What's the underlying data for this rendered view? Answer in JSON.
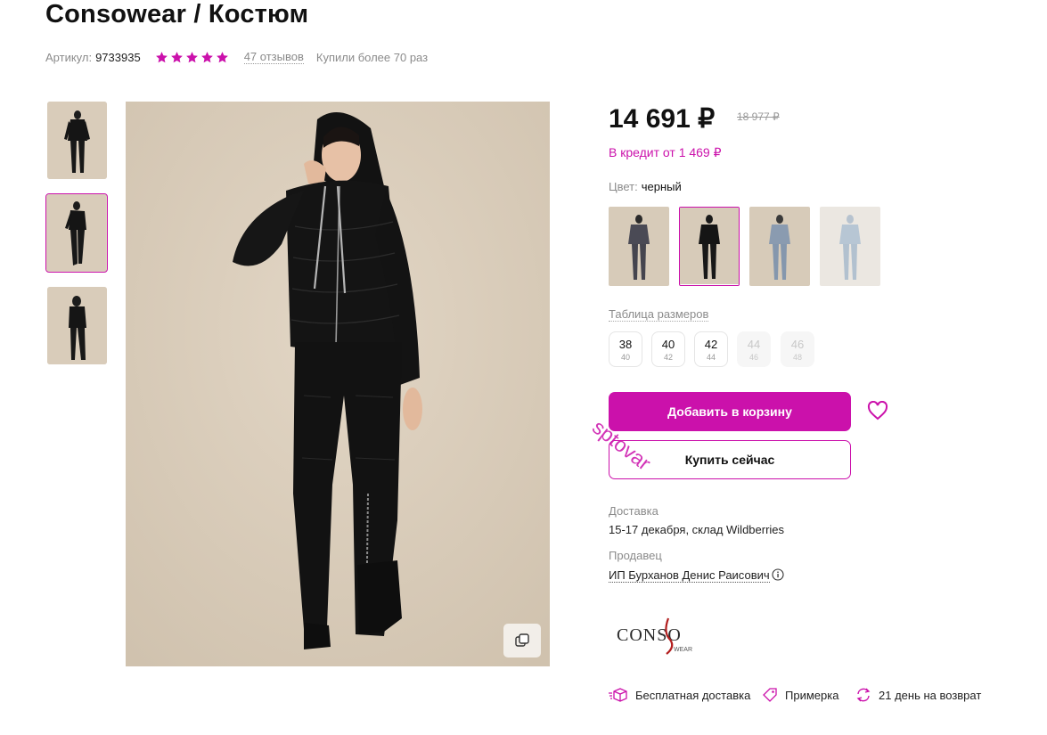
{
  "product": {
    "title": "Consowear / Костюм",
    "article_label": "Артикул:",
    "article_value": "9733935",
    "rating_stars": 5,
    "reviews": "47 отзывов",
    "purchases": "Купили более 70 раз"
  },
  "price": {
    "current": "14 691 ₽",
    "old": "18 977 ₽",
    "credit": "В кредит от 1 469 ₽"
  },
  "color": {
    "label": "Цвет:",
    "value": "черный",
    "swatches": [
      "graphite",
      "black",
      "gray-blue",
      "light-blue"
    ],
    "selected_index": 1
  },
  "sizes": {
    "table_label": "Таблица размеров",
    "items": [
      {
        "size": "38",
        "ru": "40",
        "available": true
      },
      {
        "size": "40",
        "ru": "42",
        "available": true
      },
      {
        "size": "42",
        "ru": "44",
        "available": true
      },
      {
        "size": "44",
        "ru": "46",
        "available": false
      },
      {
        "size": "46",
        "ru": "48",
        "available": false
      }
    ]
  },
  "buttons": {
    "add_to_cart": "Добавить в корзину",
    "buy_now": "Купить сейчас"
  },
  "watermark": "sptovar",
  "delivery": {
    "label": "Доставка",
    "value": "15-17 декабря, склад Wildberries"
  },
  "seller": {
    "label": "Продавец",
    "value": "ИП Бурханов Денис Раисович"
  },
  "brand_logo": "CONSO",
  "brand_logo_sub": "WEAR",
  "footer": {
    "free_delivery": "Бесплатная доставка",
    "try_on": "Примерка",
    "returns": "21 день на возврат"
  },
  "colors": {
    "accent": "#cb11ab",
    "star": "#cb11ab",
    "photo_bg": "#dacdbb"
  },
  "icons": [
    "star-icon",
    "heart-icon",
    "info-icon",
    "zoom-icon",
    "box-icon",
    "tag-icon",
    "return-icon"
  ]
}
